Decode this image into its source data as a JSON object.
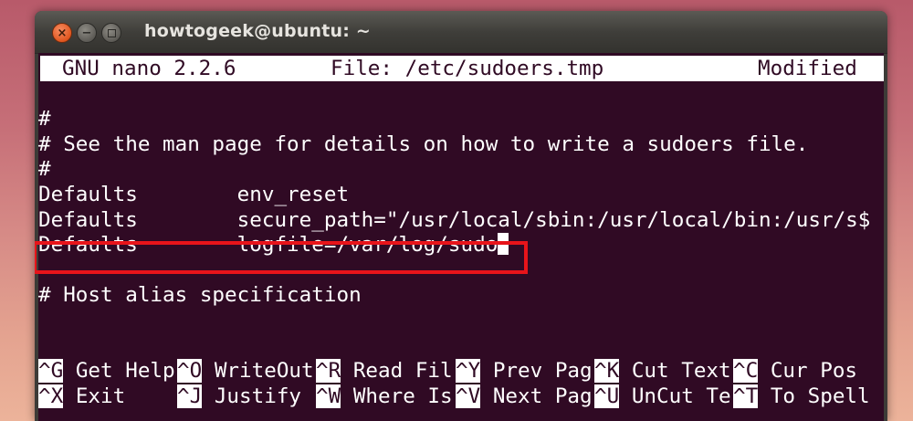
{
  "window": {
    "title": "howtogeek@ubuntu: ~",
    "controls": {
      "close": "×",
      "minimize": "−"
    }
  },
  "nano_header": {
    "version": "GNU nano 2.2.6",
    "file": "File: /etc/sudoers.tmp",
    "status": "Modified"
  },
  "editor": {
    "lines": [
      "#",
      "# See the man page for details on how to write a sudoers file.",
      "#",
      "Defaults        env_reset",
      "Defaults        secure_path=\"/usr/local/sbin:/usr/local/bin:/usr/s$",
      "Defaults        logfile=/var/log/sudo",
      "",
      "# Host alias specification"
    ]
  },
  "shortcuts": {
    "row1": [
      {
        "key": "^G",
        "label": " Get Help"
      },
      {
        "key": "^O",
        "label": " WriteOut"
      },
      {
        "key": "^R",
        "label": " Read Fil"
      },
      {
        "key": "^Y",
        "label": " Prev Pag"
      },
      {
        "key": "^K",
        "label": " Cut Text"
      },
      {
        "key": "^C",
        "label": " Cur Pos"
      }
    ],
    "row2": [
      {
        "key": "^X",
        "label": " Exit"
      },
      {
        "key": "^J",
        "label": " Justify"
      },
      {
        "key": "^W",
        "label": " Where Is"
      },
      {
        "key": "^V",
        "label": " Next Pag"
      },
      {
        "key": "^U",
        "label": " UnCut Te"
      },
      {
        "key": "^T",
        "label": " To Spell"
      }
    ]
  },
  "colors": {
    "terminal_bg": "#300a24",
    "text": "#ffffff",
    "highlight_border": "#e8141a"
  }
}
